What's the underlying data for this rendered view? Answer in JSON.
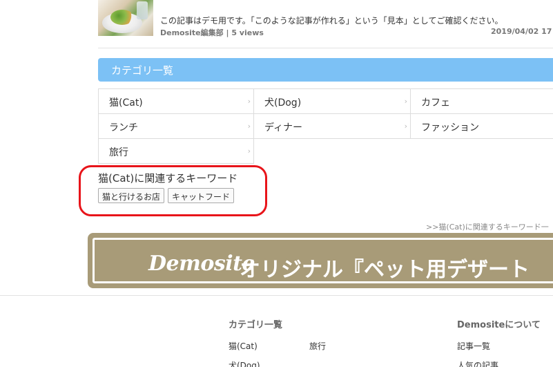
{
  "article": {
    "description": "この記事はデモ用です。「このような記事が作れる」という「見本」としてご確認ください。",
    "meta": "Demosite編集部 | 5 views",
    "date": "2019/04/02 17"
  },
  "category_section": {
    "title": "カテゴリ一覧",
    "items": [
      "猫(Cat)",
      "犬(Dog)",
      "カフェ",
      "ランチ",
      "ディナー",
      "ファッション",
      "旅行"
    ],
    "chevron": "›"
  },
  "keywords": {
    "title": "猫(Cat)に関連するキーワード",
    "tags": [
      "猫と行けるお店",
      "キャットフード"
    ],
    "more_link": ">>猫(Cat)に関連するキーワード一"
  },
  "banner": {
    "logo": "Demosite",
    "text": "オリジナル『ペット用デザート"
  },
  "footer": {
    "category_heading": "カテゴリ一覧",
    "category_links": [
      "猫(Cat)",
      "旅行",
      "犬(Dog)"
    ],
    "about_heading": "Demositeについて",
    "about_links": [
      "記事一覧",
      "人気の記事"
    ]
  },
  "colors": {
    "header_blue": "#7cc1f5",
    "highlight_red": "#e8141a",
    "banner_tan": "#a89b78"
  }
}
